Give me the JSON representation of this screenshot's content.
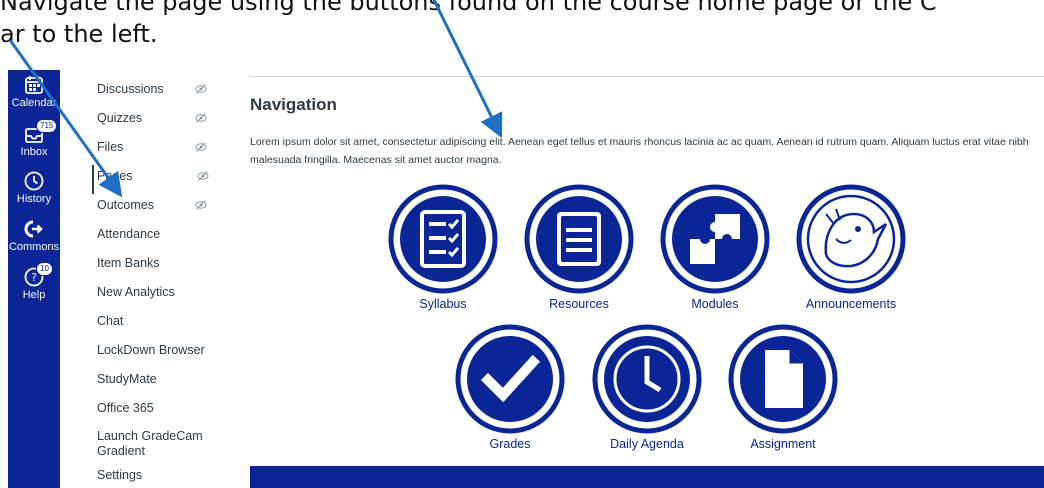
{
  "instruction": {
    "line1": "Navigate the page using the buttons found on the course home page or the C",
    "line2": "ar to the left."
  },
  "global_nav": [
    {
      "label": "Calendar",
      "icon": "calendar-icon"
    },
    {
      "label": "Inbox",
      "icon": "inbox-icon",
      "badge": "715"
    },
    {
      "label": "History",
      "icon": "clock-icon"
    },
    {
      "label": "Commons",
      "icon": "commons-icon"
    },
    {
      "label": "Help",
      "icon": "help-icon",
      "badge": "10"
    }
  ],
  "course_nav": [
    {
      "label": "Discussions",
      "hidden": true
    },
    {
      "label": "Quizzes",
      "hidden": true
    },
    {
      "label": "Files",
      "hidden": true
    },
    {
      "label": "Pages",
      "hidden": true
    },
    {
      "label": "Outcomes",
      "hidden": true
    },
    {
      "label": "Attendance"
    },
    {
      "label": "Item Banks"
    },
    {
      "label": "New Analytics"
    },
    {
      "label": "Chat"
    },
    {
      "label": "LockDown Browser"
    },
    {
      "label": "StudyMate"
    },
    {
      "label": "Office 365"
    },
    {
      "label": "Launch GradeCam Gradient"
    },
    {
      "label": "Settings"
    }
  ],
  "page": {
    "title": "Navigation",
    "body": "Lorem ipsum dolor sit amet, consectetur adipiscing elit. Aenean eget tellus et mauris rhoncus lacinia ac ac quam. Aenean id rutrum quam. Aliquam luctus erat vitae nibh malesuada fringilla. Maecenas sit amet auctor magna."
  },
  "buttons": [
    {
      "label": "Syllabus",
      "icon": "syllabus-checklist-icon"
    },
    {
      "label": "Resources",
      "icon": "resources-book-icon"
    },
    {
      "label": "Modules",
      "icon": "modules-puzzle-icon"
    },
    {
      "label": "Announcements",
      "icon": "announcements-mascot-icon"
    },
    {
      "label": "Grades",
      "icon": "grades-checkmark-icon"
    },
    {
      "label": "Daily Agenda",
      "icon": "daily-agenda-clock-icon"
    },
    {
      "label": "Assignment",
      "icon": "assignment-document-icon"
    }
  ],
  "colors": {
    "brand_blue": "#0a2596",
    "text": "#2d3b45",
    "arrow": "#1f6fc4"
  }
}
